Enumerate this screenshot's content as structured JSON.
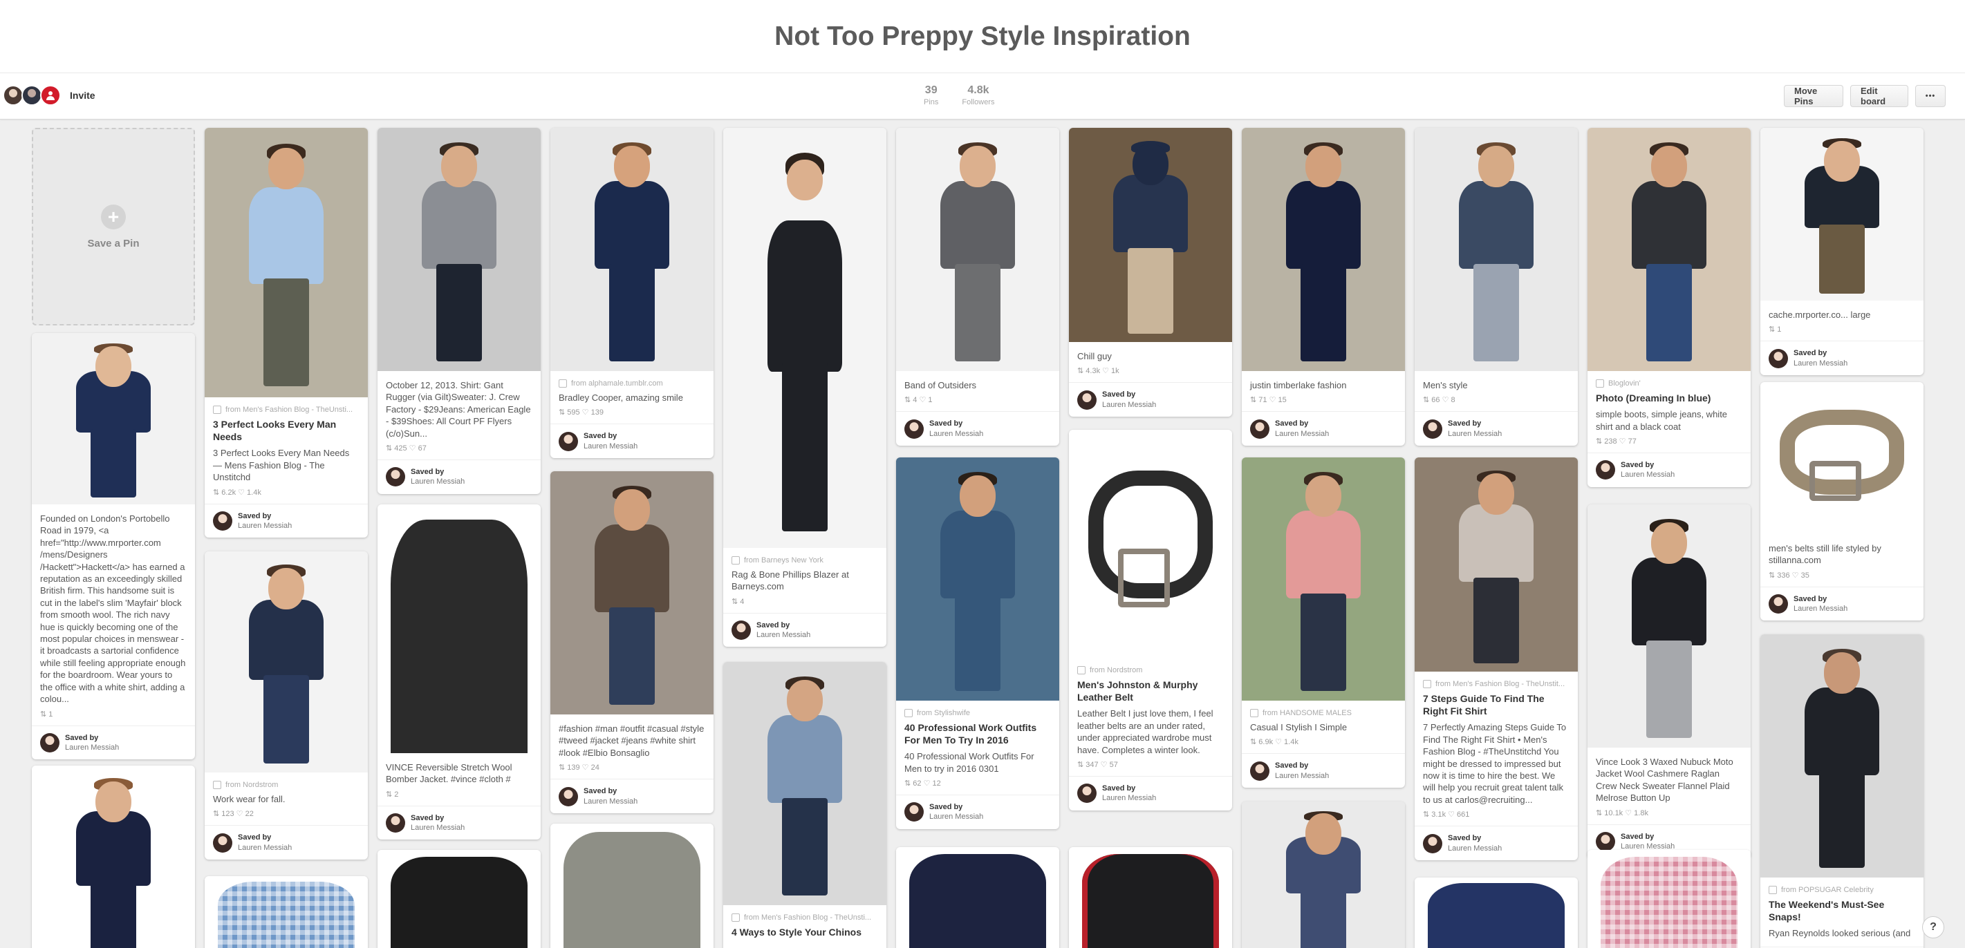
{
  "board": {
    "title": "Not Too Preppy Style Inspiration"
  },
  "toolbar": {
    "invite_label": "Invite",
    "pins_count": "39",
    "pins_label": "Pins",
    "followers_count": "4.8k",
    "followers_label": "Followers",
    "move_pins_label": "Move Pins",
    "edit_board_label": "Edit board",
    "more_label": "•••"
  },
  "save_pin": {
    "label": "Save a Pin"
  },
  "saved_by": {
    "label": "Saved by",
    "user": "Lauren Messiah"
  },
  "help": {
    "label": "?"
  },
  "pins": [
    {
      "source": "",
      "title": "",
      "description": "Founded on London's Portobello Road in 1979, <a href=\"http://www.mrporter.com /mens/Designers /Hackett\">Hackett</a> has earned a reputation as an exceedingly skilled British firm. This handsome suit is cut in the label's slim 'Mayfair' block from smooth wool. The rich navy hue is quickly becoming one of the most popular choices in menswear - it broadcasts a sartorial confidence while still feeling appropriate enough for the boardroom. Wear yours to the office with a white shirt, adding a colou...",
      "stats": "⇅ 1"
    },
    {
      "source": "",
      "title": "",
      "description": "",
      "stats": ""
    },
    {
      "source": "from Men's Fashion Blog - TheUnsti...",
      "title": "3 Perfect Looks Every Man Needs",
      "description": "3 Perfect Looks Every Man Needs — Mens Fashion Blog - The Unstitchd",
      "stats": "⇅ 6.2k   ♡ 1.4k"
    },
    {
      "source": "from Nordstrom",
      "title": "",
      "description": "Work wear for fall.",
      "stats": "⇅ 123   ♡ 22"
    },
    {
      "source": "",
      "title": "",
      "description": "",
      "stats": ""
    },
    {
      "source": "",
      "title": "",
      "description": "October 12, 2013.  Shirt: Gant Rugger (via Gilt)Sweater: J. Crew Factory - $29Jeans: American Eagle - $39Shoes: All Court PF Flyers (c/o)Sun...",
      "stats": "⇅ 425   ♡ 67"
    },
    {
      "source": "",
      "title": "",
      "description": "VINCE Reversible Stretch Wool Bomber Jacket. #vince #cloth #",
      "stats": "⇅ 2"
    },
    {
      "source": "",
      "title": "",
      "description": "",
      "stats": ""
    },
    {
      "source": "from alphamale.tumblr.com",
      "title": "",
      "description": "Bradley Cooper, amazing smile",
      "stats": "⇅ 595   ♡ 139"
    },
    {
      "source": "",
      "title": "",
      "description": "#fashion #man #outfit #casual #style #tweed #jacket #jeans #white shirt #look #Elbio Bonsaglio",
      "stats": "⇅ 139   ♡ 24"
    },
    {
      "source": "",
      "title": "",
      "description": "",
      "stats": ""
    },
    {
      "source": "from Barneys New York",
      "title": "",
      "description": "Rag & Bone Phillips Blazer at Barneys.com",
      "stats": "⇅ 4"
    },
    {
      "source": "from Men's Fashion Blog - TheUnsti...",
      "title": "4 Ways to Style Your Chinos",
      "description": "",
      "stats": ""
    },
    {
      "source": "",
      "title": "",
      "description": "Band of Outsiders",
      "stats": "⇅ 4   ♡ 1"
    },
    {
      "source": "from Stylishwife",
      "title": "40 Professional Work Outfits For Men To Try In 2016",
      "description": "40 Professional Work Outfits For Men to try in 2016 0301",
      "stats": "⇅ 62   ♡ 12"
    },
    {
      "source": "",
      "title": "",
      "description": "",
      "stats": ""
    },
    {
      "source": "",
      "title": "",
      "description": "Chill guy",
      "stats": "⇅ 4.3k   ♡ 1k"
    },
    {
      "source": "from Nordstrom",
      "title": "Men's Johnston & Murphy Leather Belt",
      "description": "Leather Belt I just love them, I feel leather belts are an under rated, under appreciated wardrobe must have. Completes a winter look.",
      "stats": "⇅ 347   ♡ 57"
    },
    {
      "source": "",
      "title": "",
      "description": "",
      "stats": ""
    },
    {
      "source": "",
      "title": "",
      "description": "justin timberlake fashion",
      "stats": "⇅ 71   ♡ 15"
    },
    {
      "source": "from HANDSOME MALES",
      "title": "",
      "description": "Casual I Stylish I Simple",
      "stats": "⇅ 6.9k   ♡ 1.4k"
    },
    {
      "source": "",
      "title": "",
      "description": "",
      "stats": ""
    },
    {
      "source": "",
      "title": "",
      "description": "Men's style",
      "stats": "⇅ 66   ♡ 8"
    },
    {
      "source": "from Men's Fashion Blog - TheUnstit...",
      "title": "7 Steps Guide To Find The Right Fit Shirt",
      "description": "7 Perfectly Amazing Steps Guide To Find The Right Fit Shirt  •  Men's Fashion Blog - #TheUnstitchd You might be dressed to impressed but now it is time to hire the best. We will help you recruit great talent talk to us at carlos@recruiting...",
      "stats": "⇅ 3.1k   ♡ 661"
    },
    {
      "source": "",
      "title": "",
      "description": "",
      "stats": ""
    },
    {
      "source": "Bloglovin'",
      "title": "Photo (Dreaming In blue)",
      "description": "simple boots, simple jeans, white shirt and a black coat",
      "stats": "⇅ 238   ♡ 77"
    },
    {
      "source": "",
      "title": "",
      "description": "Vince Look 3 Waxed Nubuck Moto Jacket Wool Cashmere Raglan Crew Neck Sweater Flannel Plaid Melrose Button Up",
      "stats": "⇅ 10.1k   ♡ 1.8k"
    },
    {
      "source": "",
      "title": "",
      "description": "",
      "stats": ""
    },
    {
      "source": "",
      "title": "",
      "description": "cache.mrporter.co... large",
      "stats": "⇅ 1"
    },
    {
      "source": "",
      "title": "",
      "description": "men's belts still life styled by stillanna.com",
      "stats": "⇅ 336   ♡ 35"
    },
    {
      "source": "from POPSUGAR Celebrity",
      "title": "The Weekend's Must-See Snaps!",
      "description": "Ryan Reynolds looked serious (and",
      "stats": ""
    }
  ]
}
